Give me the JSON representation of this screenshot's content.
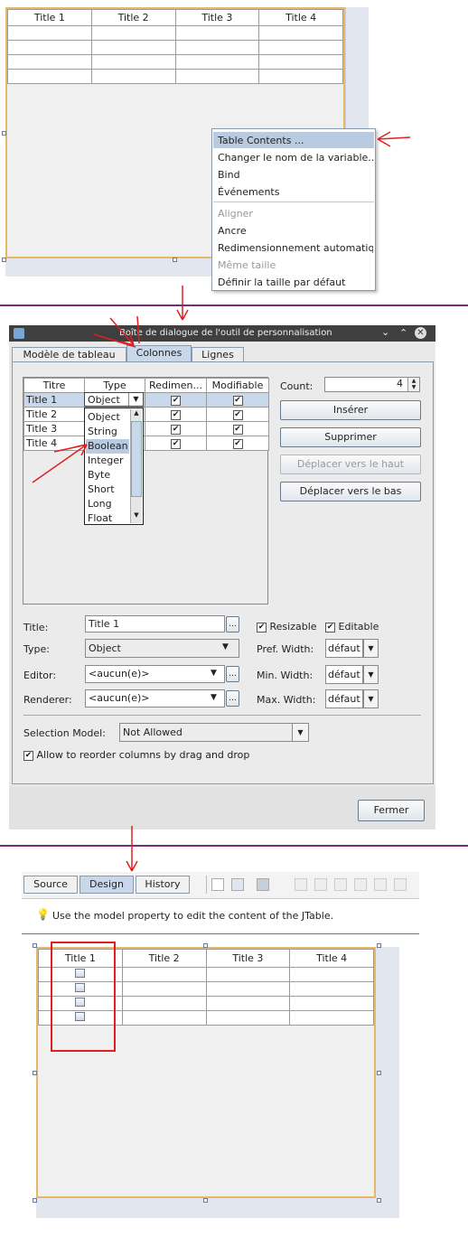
{
  "designer_top": {
    "columns": [
      "Title 1",
      "Title 2",
      "Title 3",
      "Title 4"
    ],
    "row_count": 4
  },
  "context_menu": {
    "items": [
      {
        "label": "Table Contents ...",
        "state": "highlighted"
      },
      {
        "label": "Changer le nom de la variable...",
        "state": "normal"
      },
      {
        "label": "Bind",
        "state": "normal"
      },
      {
        "label": "Événements",
        "state": "normal"
      },
      {
        "label": "Aligner",
        "state": "disabled"
      },
      {
        "label": "Ancre",
        "state": "normal"
      },
      {
        "label": "Redimensionnement automatique",
        "state": "normal"
      },
      {
        "label": "Même taille",
        "state": "disabled"
      },
      {
        "label": "Définir la taille par défaut",
        "state": "normal"
      }
    ]
  },
  "dialog": {
    "title": "Boîte de dialogue de l'outil de personnalisation",
    "tabs": [
      "Modèle de tableau",
      "Colonnes",
      "Lignes"
    ],
    "active_tab": "Colonnes",
    "columns_table": {
      "headers": [
        "Titre",
        "Type",
        "Redimen...",
        "Modifiable"
      ],
      "rows": [
        {
          "title": "Title 1",
          "type": "Object"
        },
        {
          "title": "Title 2",
          "type": ""
        },
        {
          "title": "Title 3",
          "type": ""
        },
        {
          "title": "Title 4",
          "type": ""
        }
      ]
    },
    "type_dropdown_options": [
      "Object",
      "String",
      "Boolean",
      "Integer",
      "Byte",
      "Short",
      "Long",
      "Float"
    ],
    "type_dropdown_highlight": "Boolean",
    "count_label": "Count:",
    "count_value": "4",
    "buttons": {
      "insert": "Insérer",
      "delete": "Supprimer",
      "move_up": "Déplacer vers le haut",
      "move_down": "Déplacer vers le bas",
      "close": "Fermer"
    },
    "props": {
      "title_label": "Title:",
      "title_value": "Title 1",
      "type_label": "Type:",
      "type_value": "Object",
      "editor_label": "Editor:",
      "editor_value": "<aucun(e)>",
      "renderer_label": "Renderer:",
      "renderer_value": "<aucun(e)>",
      "resizable_label": "Resizable",
      "editable_label": "Editable",
      "pref_width_label": "Pref. Width:",
      "min_width_label": "Min. Width:",
      "max_width_label": "Max. Width:",
      "width_value": "défaut"
    },
    "selection_model_label": "Selection Model:",
    "selection_model_value": "Not Allowed",
    "reorder_label": "Allow to reorder columns by drag and drop"
  },
  "editor": {
    "tabs": [
      "Source",
      "Design",
      "History"
    ],
    "active_tab": "Design",
    "hint": "Use the model property to edit the content of the JTable.",
    "columns": [
      "Title 1",
      "Title 2",
      "Title 3",
      "Title 4"
    ],
    "row_count": 4
  },
  "colors": {
    "annotation": "#e02020",
    "divider": "#7a2a7a",
    "selection": "#b8cbe0",
    "form_border": "#e8b868"
  },
  "icons": [
    "down-arrow",
    "lightbulb-icon",
    "checkmark-icon"
  ]
}
